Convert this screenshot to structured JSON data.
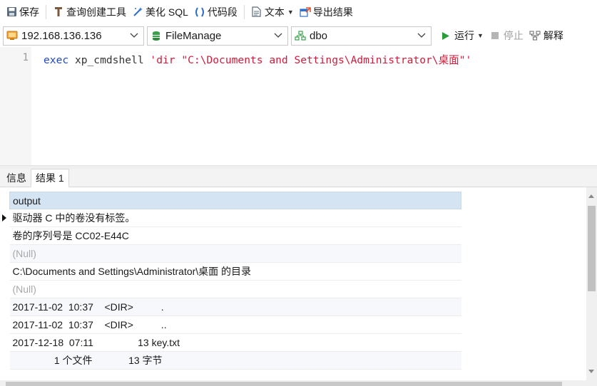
{
  "toolbar": {
    "save": "保存",
    "query_builder": "查询创建工具",
    "beautify_sql": "美化 SQL",
    "snippet": "代码段",
    "text": "文本",
    "export": "导出结果"
  },
  "connection": {
    "server": "192.168.136.136",
    "database": "FileManage",
    "schema": "dbo",
    "run": "运行",
    "stop": "停止",
    "explain": "解释"
  },
  "editor": {
    "line_number": "1",
    "keyword": "exec",
    "identifier": "xp_cmdshell",
    "string": "'dir \"C:\\Documents and Settings\\Administrator\\桌面\"'"
  },
  "result_tabs": [
    {
      "label": "信息",
      "active": false
    },
    {
      "label": "结果 1",
      "active": true
    }
  ],
  "grid": {
    "column": "output",
    "rows": [
      {
        "text": "驱动器 C 中的卷没有标签。",
        "null": false
      },
      {
        "text": "卷的序列号是 CC02-E44C",
        "null": false
      },
      {
        "text": "(Null)",
        "null": true
      },
      {
        "text": "C:\\Documents and Settings\\Administrator\\桌面 的目录",
        "null": false
      },
      {
        "text": "(Null)",
        "null": true
      },
      {
        "text": "2017-11-02  10:37    <DIR>          .",
        "null": false
      },
      {
        "text": "2017-11-02  10:37    <DIR>          ..",
        "null": false
      },
      {
        "text": "2017-12-18  07:11                13 key.txt",
        "null": false
      },
      {
        "text": "               1 个文件             13 字节",
        "null": false
      }
    ]
  },
  "colors": {
    "header_bg": "#d5e4f3",
    "keyword": "#1f47c9",
    "string": "#d11a3a",
    "null_text": "#a8a8a8",
    "run_icon": "#2a9d3a"
  }
}
